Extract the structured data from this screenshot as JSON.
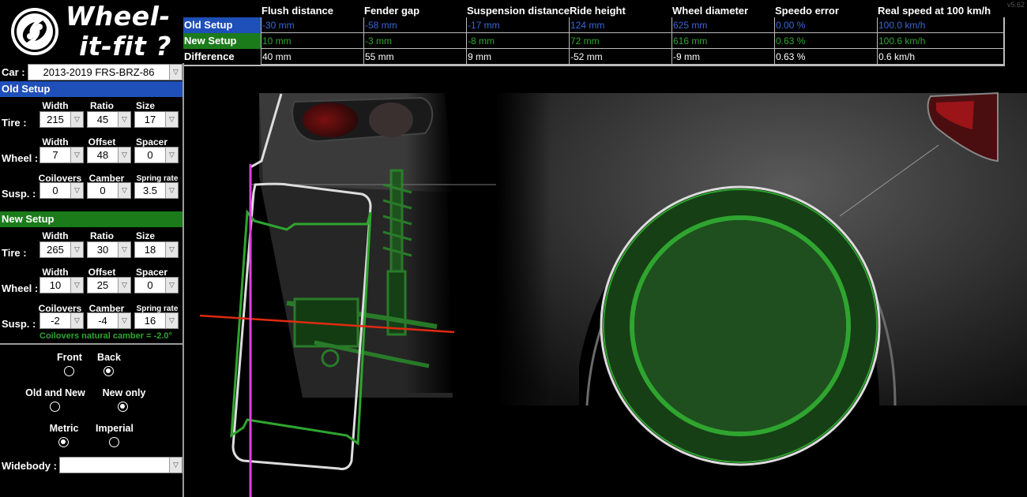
{
  "app": {
    "title_line1": "Wheel-",
    "title_line2": "it-fit ?",
    "version": "v5.62"
  },
  "colors": {
    "old_blue": "#1f4fb8",
    "new_green": "#1b7b1b",
    "new_text_green": "#2fa52f",
    "camber_line": "#e02a10",
    "flush_line": "#e040e0"
  },
  "results": {
    "headers": [
      "Flush distance",
      "Fender gap",
      "Suspension distance",
      "Ride height",
      "Wheel diameter",
      "Speedo error",
      "Real speed at 100 km/h"
    ],
    "rows": [
      {
        "label": "Old Setup",
        "values": [
          "-30 mm",
          "-58 mm",
          "-17 mm",
          "124 mm",
          "625 mm",
          "0.00 %",
          "100.0 km/h"
        ]
      },
      {
        "label": "New Setup",
        "values": [
          "10 mm",
          "-3 mm",
          "-8 mm",
          "72 mm",
          "616 mm",
          "0.63 %",
          "100.6 km/h"
        ]
      },
      {
        "label": "Difference",
        "values": [
          "40 mm",
          "55 mm",
          "9 mm",
          "-52 mm",
          "-9 mm",
          "0.63 %",
          "0.6 km/h"
        ]
      }
    ]
  },
  "car": {
    "label": "Car :",
    "value": "2013-2019 FRS-BRZ-86"
  },
  "old_setup": {
    "title": "Old Setup",
    "tire": {
      "label": "Tire :",
      "heads": [
        "Width",
        "Ratio",
        "Size"
      ],
      "values": [
        "215",
        "45",
        "17"
      ]
    },
    "wheel": {
      "label": "Wheel :",
      "heads": [
        "Width",
        "Offset",
        "Spacer"
      ],
      "values": [
        "7",
        "48",
        "0"
      ]
    },
    "susp": {
      "label": "Susp. :",
      "heads": [
        "Coilovers",
        "Camber",
        "Spring rate"
      ],
      "values": [
        "0",
        "0",
        "3.5"
      ]
    }
  },
  "new_setup": {
    "title": "New Setup",
    "tire": {
      "label": "Tire :",
      "heads": [
        "Width",
        "Ratio",
        "Size"
      ],
      "values": [
        "265",
        "30",
        "18"
      ]
    },
    "wheel": {
      "label": "Wheel :",
      "heads": [
        "Width",
        "Offset",
        "Spacer"
      ],
      "values": [
        "10",
        "25",
        "0"
      ]
    },
    "susp": {
      "label": "Susp. :",
      "heads": [
        "Coilovers",
        "Camber",
        "Spring rate"
      ],
      "values": [
        "-2",
        "-4",
        "16"
      ]
    },
    "note": "Coilovers natural camber = -2.0°"
  },
  "options": {
    "front_label": "Front",
    "back_label": "Back",
    "axle_selected": "Back",
    "old_new_label": "Old and New",
    "new_only_label": "New only",
    "view_selected": "New only",
    "metric_label": "Metric",
    "imperial_label": "Imperial",
    "units_selected": "Metric"
  },
  "widebody": {
    "label": "Widebody :",
    "value": ""
  },
  "viewport": {
    "camber_deg": -4,
    "flush_distance_mm": 10,
    "new_tire_ratio_pct": 30
  }
}
